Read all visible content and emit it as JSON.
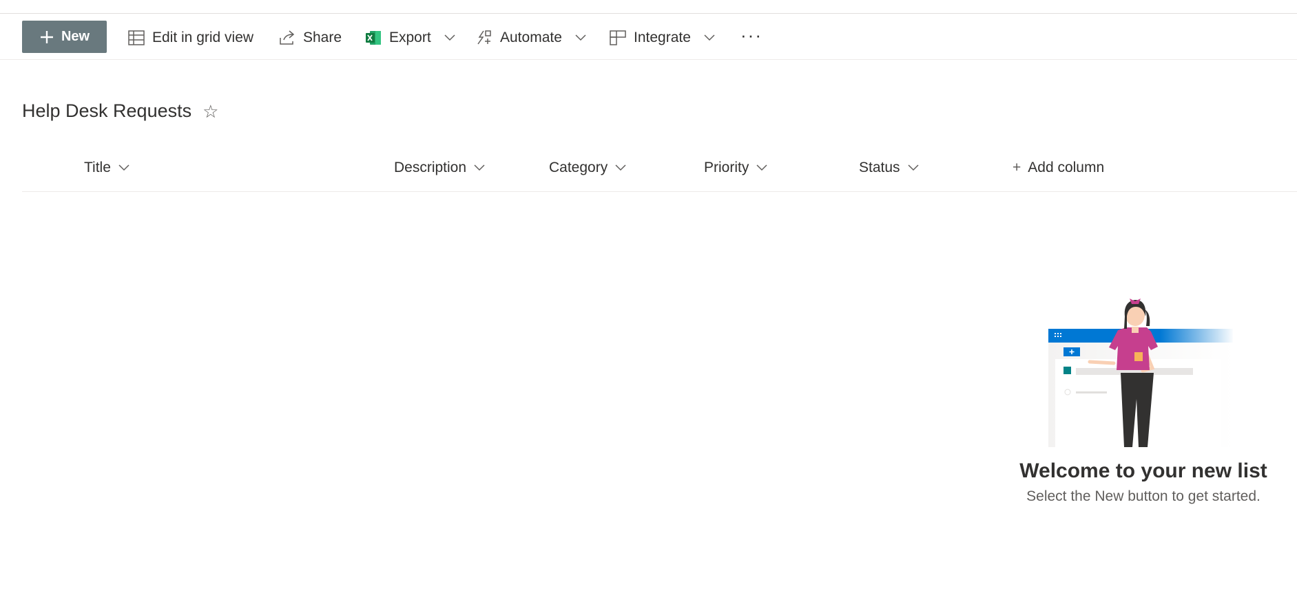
{
  "toolbar": {
    "new_label": "New",
    "edit_grid_label": "Edit in grid view",
    "share_label": "Share",
    "export_label": "Export",
    "automate_label": "Automate",
    "integrate_label": "Integrate",
    "more_label": "···"
  },
  "list": {
    "title": "Help Desk Requests",
    "favorite_icon": "☆",
    "columns": [
      "Title",
      "Description",
      "Category",
      "Priority",
      "Status"
    ],
    "add_column_label": "Add column",
    "add_column_icon": "+"
  },
  "empty_state": {
    "title": "Welcome to your new list",
    "subtitle": "Select the New button to get started."
  },
  "colors": {
    "new_button_bg": "#69797e",
    "illustration_header": "#0078d4",
    "accent_pink": "#c63f8e",
    "excel_green": "#107c41",
    "teal": "#038387"
  },
  "icons": [
    "plus-icon",
    "grid-icon",
    "share-icon",
    "excel-icon",
    "automate-icon",
    "integrate-icon",
    "chevron-down-icon",
    "more-icon",
    "star-icon"
  ]
}
